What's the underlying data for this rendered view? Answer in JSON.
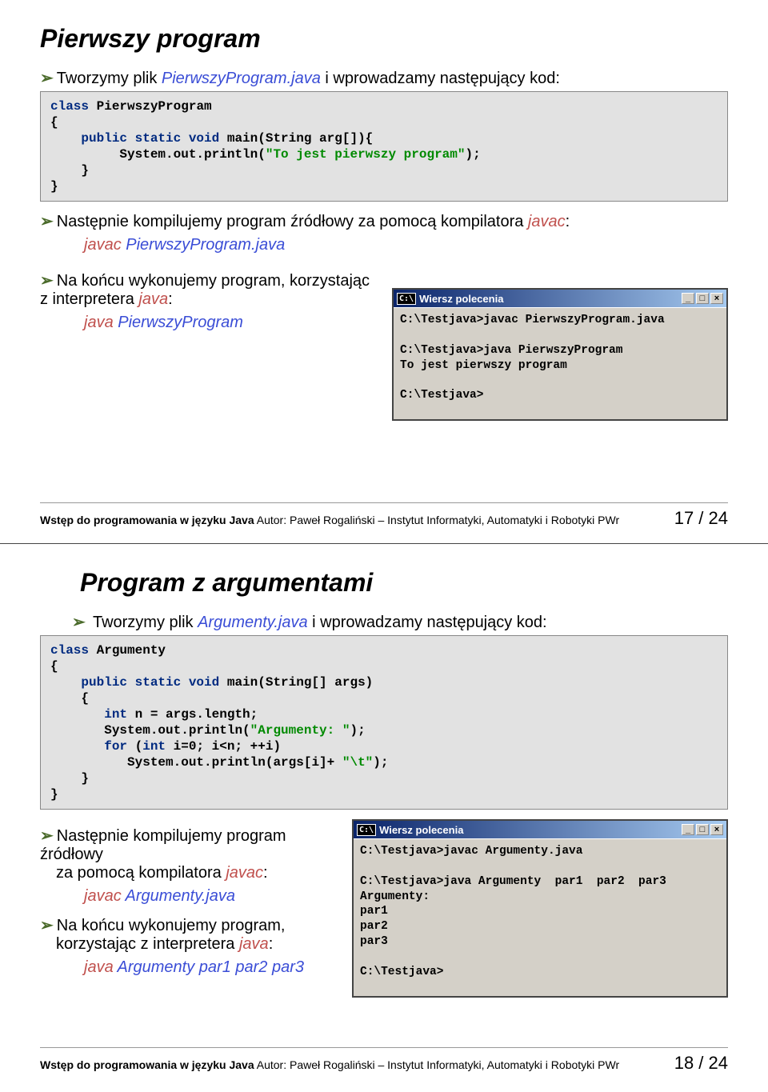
{
  "slide1": {
    "title": "Pierwszy program",
    "b1_pre": "Tworzymy plik ",
    "b1_file": "PierwszyProgram.java",
    "b1_post": " i wprowadzamy następujący kod:",
    "code1_l1a": "class",
    "code1_l1b": " PierwszyProgram",
    "code1_l2": "{",
    "code1_l3a": "    public static void",
    "code1_l3b": " main(String arg[]){",
    "code1_l4a": "         System.out.println(",
    "code1_l4b": "\"To jest pierwszy program\"",
    "code1_l4c": ");",
    "code1_l5": "    }",
    "code1_l6": "}",
    "b2_pre": "Następnie kompilujemy program źródłowy za pomocą kompilatora ",
    "b2_javac": "javac",
    "b2_colon": ":",
    "cmd2a": "javac  ",
    "cmd2b": "PierwszyProgram.java",
    "b3_pre": "Na końcu wykonujemy program, korzystając z interpretera ",
    "b3_java": "java",
    "b3_colon": ":",
    "cmd3a": "java  ",
    "cmd3b": "PierwszyProgram",
    "console_title": "Wiersz polecenia",
    "console_lines": "C:\\Testjava>javac PierwszyProgram.java\n\nC:\\Testjava>java PierwszyProgram\nTo jest pierwszy program\n\nC:\\Testjava>",
    "footer_strong": "Wstęp do programowania w języku Java",
    "footer_rest": "   Autor: Paweł Rogaliński – Instytut Informatyki, Automatyki i Robotyki PWr",
    "page": "17 / 24"
  },
  "slide2": {
    "title": "Program z argumentami",
    "b1_pre": "Tworzymy plik ",
    "b1_file": "Argumenty.java",
    "b1_post": " i wprowadzamy następujący kod:",
    "code2_l1a": "class",
    "code2_l1b": " Argumenty",
    "code2_l2": "{",
    "code2_l3a": "    public static void",
    "code2_l3b": " main(String[] args)",
    "code2_l4": "    {",
    "code2_l5a": "       int",
    "code2_l5b": " n = args.length;",
    "code2_l6a": "       System.out.println(",
    "code2_l6b": "\"Argumenty: \"",
    "code2_l6c": ");",
    "code2_l7a": "       for",
    "code2_l7b": " (",
    "code2_l7c": "int",
    "code2_l7d": " i=0; i<n; ++i)",
    "code2_l8a": "          System.out.println(args[i]+ ",
    "code2_l8b": "\"\\t\"",
    "code2_l8c": ");",
    "code2_l9": "    }",
    "code2_l10": "}",
    "b2_l1": "Następnie kompilujemy program źródłowy",
    "b2_l2a": "za pomocą kompilatora ",
    "b2_javac": "javac",
    "b2_colon": ":",
    "cmd2a": "javac  ",
    "cmd2b": "Argumenty.java",
    "b3_l1": "Na końcu wykonujemy program,",
    "b3_l2a": "korzystając z interpretera ",
    "b3_java": "java",
    "b3_colon": ":",
    "cmd3a": "java  ",
    "cmd3b": "Argumenty  par1  par2  par3",
    "console_title": "Wiersz polecenia",
    "console_lines": "C:\\Testjava>javac Argumenty.java\n\nC:\\Testjava>java Argumenty  par1  par2  par3\nArgumenty:\npar1\npar2\npar3\n\nC:\\Testjava>",
    "footer_strong": "Wstęp do programowania w języku Java",
    "footer_rest": "   Autor: Paweł Rogaliński – Instytut Informatyki, Automatyki i Robotyki PWr",
    "page": "18 / 24"
  },
  "ui": {
    "min": "_",
    "max": "□",
    "close": "×",
    "cx": "C:\\"
  }
}
